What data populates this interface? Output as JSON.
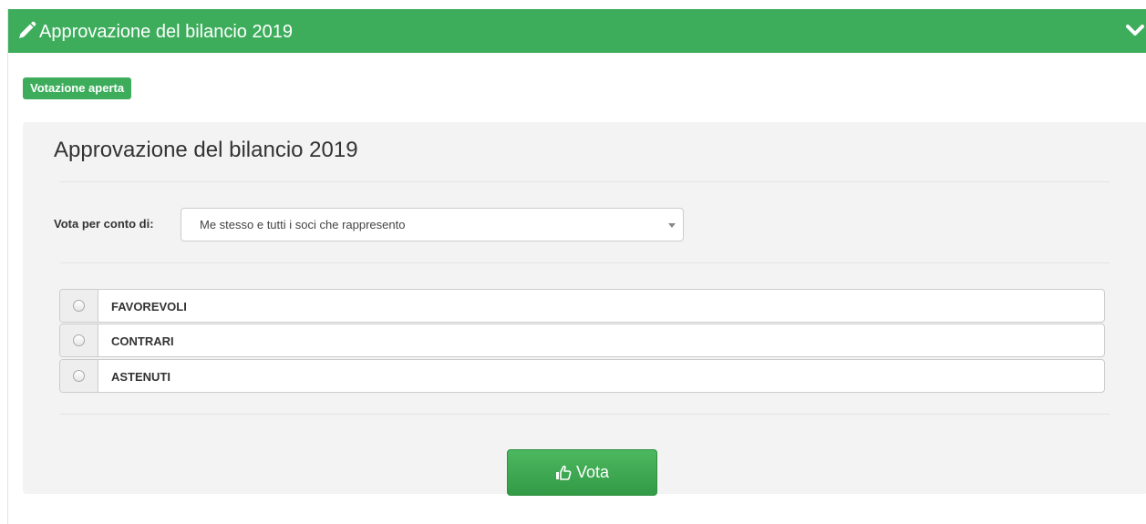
{
  "panel": {
    "title": "Approvazione del bilancio 2019",
    "header_color": "#3dad5c",
    "icons": {
      "edit": "pencil-icon",
      "collapse": "chevron-down-icon"
    }
  },
  "status": {
    "label": "Votazione aperta"
  },
  "form": {
    "title": "Approvazione del bilancio 2019",
    "vote_on_behalf": {
      "label": "Vota per conto di:",
      "selected": "Me stesso e tutti i soci che rappresento"
    },
    "options": [
      {
        "label": "FAVOREVOLI",
        "selected": false
      },
      {
        "label": "CONTRARI",
        "selected": false
      },
      {
        "label": "ASTENUTI",
        "selected": false
      }
    ],
    "submit": {
      "label": "Vota",
      "icon": "thumbs-up-icon"
    }
  }
}
